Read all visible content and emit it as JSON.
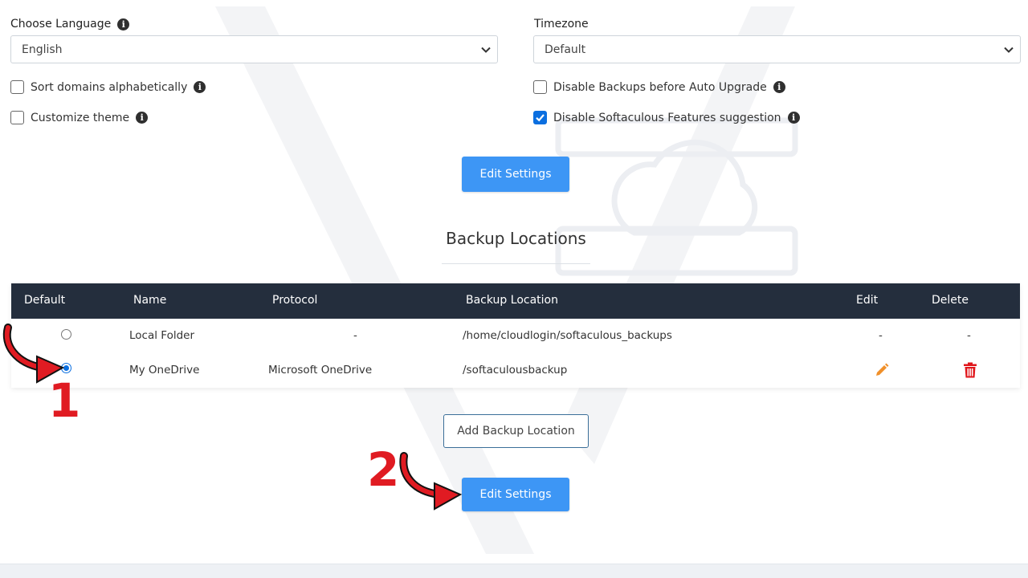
{
  "settings": {
    "language": {
      "label": "Choose Language",
      "value": "English"
    },
    "timezone": {
      "label": "Timezone",
      "value": "Default"
    },
    "checkboxes": [
      {
        "label": "Sort domains alphabetically",
        "checked": false
      },
      {
        "label": "Customize theme",
        "checked": false
      },
      {
        "label": "Disable Backups before Auto Upgrade",
        "checked": false
      },
      {
        "label": "Disable Softaculous Features suggestion",
        "checked": true
      }
    ],
    "edit_settings_label": "Edit Settings"
  },
  "backup": {
    "title": "Backup Locations",
    "columns": [
      "Default",
      "Name",
      "Protocol",
      "Backup Location",
      "Edit",
      "Delete"
    ],
    "rows": [
      {
        "default": false,
        "name": "Local Folder",
        "protocol": "-",
        "location": "/home/cloudlogin/softaculous_backups",
        "edit": "-",
        "delete": "-"
      },
      {
        "default": true,
        "name": "My OneDrive",
        "protocol": "Microsoft OneDrive",
        "location": "/softaculousbackup",
        "edit_icon": "pencil-icon",
        "delete_icon": "trash-icon"
      }
    ],
    "add_label": "Add Backup Location",
    "edit_settings_label": "Edit Settings"
  },
  "annotations": {
    "step1": "1",
    "step2": "2"
  },
  "colors": {
    "primary_button": "#3d96f5",
    "table_header": "#242e3d",
    "annotation": "#e01b22",
    "edit_icon": "#f0902a",
    "delete_icon": "#e0161b"
  }
}
